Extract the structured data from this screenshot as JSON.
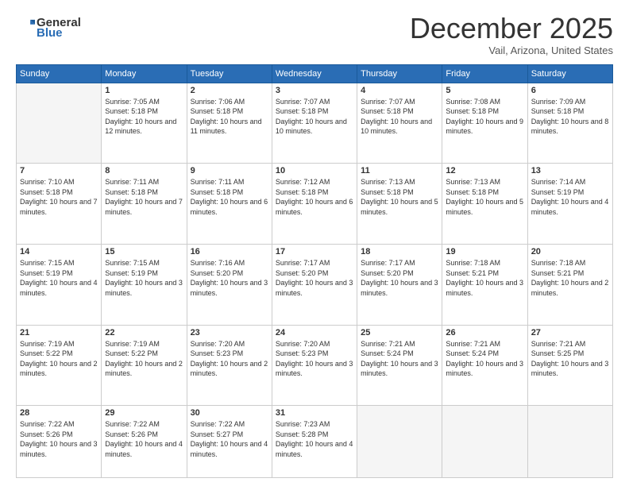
{
  "header": {
    "logo_general": "General",
    "logo_blue": "Blue",
    "month_title": "December 2025",
    "location": "Vail, Arizona, United States"
  },
  "calendar": {
    "days_of_week": [
      "Sunday",
      "Monday",
      "Tuesday",
      "Wednesday",
      "Thursday",
      "Friday",
      "Saturday"
    ],
    "weeks": [
      [
        {
          "day": "",
          "empty": true
        },
        {
          "day": "1",
          "sunrise": "7:05 AM",
          "sunset": "5:18 PM",
          "daylight": "10 hours and 12 minutes."
        },
        {
          "day": "2",
          "sunrise": "7:06 AM",
          "sunset": "5:18 PM",
          "daylight": "10 hours and 11 minutes."
        },
        {
          "day": "3",
          "sunrise": "7:07 AM",
          "sunset": "5:18 PM",
          "daylight": "10 hours and 10 minutes."
        },
        {
          "day": "4",
          "sunrise": "7:07 AM",
          "sunset": "5:18 PM",
          "daylight": "10 hours and 10 minutes."
        },
        {
          "day": "5",
          "sunrise": "7:08 AM",
          "sunset": "5:18 PM",
          "daylight": "10 hours and 9 minutes."
        },
        {
          "day": "6",
          "sunrise": "7:09 AM",
          "sunset": "5:18 PM",
          "daylight": "10 hours and 8 minutes."
        }
      ],
      [
        {
          "day": "7",
          "sunrise": "7:10 AM",
          "sunset": "5:18 PM",
          "daylight": "10 hours and 7 minutes."
        },
        {
          "day": "8",
          "sunrise": "7:11 AM",
          "sunset": "5:18 PM",
          "daylight": "10 hours and 7 minutes."
        },
        {
          "day": "9",
          "sunrise": "7:11 AM",
          "sunset": "5:18 PM",
          "daylight": "10 hours and 6 minutes."
        },
        {
          "day": "10",
          "sunrise": "7:12 AM",
          "sunset": "5:18 PM",
          "daylight": "10 hours and 6 minutes."
        },
        {
          "day": "11",
          "sunrise": "7:13 AM",
          "sunset": "5:18 PM",
          "daylight": "10 hours and 5 minutes."
        },
        {
          "day": "12",
          "sunrise": "7:13 AM",
          "sunset": "5:18 PM",
          "daylight": "10 hours and 5 minutes."
        },
        {
          "day": "13",
          "sunrise": "7:14 AM",
          "sunset": "5:19 PM",
          "daylight": "10 hours and 4 minutes."
        }
      ],
      [
        {
          "day": "14",
          "sunrise": "7:15 AM",
          "sunset": "5:19 PM",
          "daylight": "10 hours and 4 minutes."
        },
        {
          "day": "15",
          "sunrise": "7:15 AM",
          "sunset": "5:19 PM",
          "daylight": "10 hours and 3 minutes."
        },
        {
          "day": "16",
          "sunrise": "7:16 AM",
          "sunset": "5:20 PM",
          "daylight": "10 hours and 3 minutes."
        },
        {
          "day": "17",
          "sunrise": "7:17 AM",
          "sunset": "5:20 PM",
          "daylight": "10 hours and 3 minutes."
        },
        {
          "day": "18",
          "sunrise": "7:17 AM",
          "sunset": "5:20 PM",
          "daylight": "10 hours and 3 minutes."
        },
        {
          "day": "19",
          "sunrise": "7:18 AM",
          "sunset": "5:21 PM",
          "daylight": "10 hours and 3 minutes."
        },
        {
          "day": "20",
          "sunrise": "7:18 AM",
          "sunset": "5:21 PM",
          "daylight": "10 hours and 2 minutes."
        }
      ],
      [
        {
          "day": "21",
          "sunrise": "7:19 AM",
          "sunset": "5:22 PM",
          "daylight": "10 hours and 2 minutes."
        },
        {
          "day": "22",
          "sunrise": "7:19 AM",
          "sunset": "5:22 PM",
          "daylight": "10 hours and 2 minutes."
        },
        {
          "day": "23",
          "sunrise": "7:20 AM",
          "sunset": "5:23 PM",
          "daylight": "10 hours and 2 minutes."
        },
        {
          "day": "24",
          "sunrise": "7:20 AM",
          "sunset": "5:23 PM",
          "daylight": "10 hours and 3 minutes."
        },
        {
          "day": "25",
          "sunrise": "7:21 AM",
          "sunset": "5:24 PM",
          "daylight": "10 hours and 3 minutes."
        },
        {
          "day": "26",
          "sunrise": "7:21 AM",
          "sunset": "5:24 PM",
          "daylight": "10 hours and 3 minutes."
        },
        {
          "day": "27",
          "sunrise": "7:21 AM",
          "sunset": "5:25 PM",
          "daylight": "10 hours and 3 minutes."
        }
      ],
      [
        {
          "day": "28",
          "sunrise": "7:22 AM",
          "sunset": "5:26 PM",
          "daylight": "10 hours and 3 minutes."
        },
        {
          "day": "29",
          "sunrise": "7:22 AM",
          "sunset": "5:26 PM",
          "daylight": "10 hours and 4 minutes."
        },
        {
          "day": "30",
          "sunrise": "7:22 AM",
          "sunset": "5:27 PM",
          "daylight": "10 hours and 4 minutes."
        },
        {
          "day": "31",
          "sunrise": "7:23 AM",
          "sunset": "5:28 PM",
          "daylight": "10 hours and 4 minutes."
        },
        {
          "day": "",
          "empty": true
        },
        {
          "day": "",
          "empty": true
        },
        {
          "day": "",
          "empty": true
        }
      ]
    ]
  }
}
